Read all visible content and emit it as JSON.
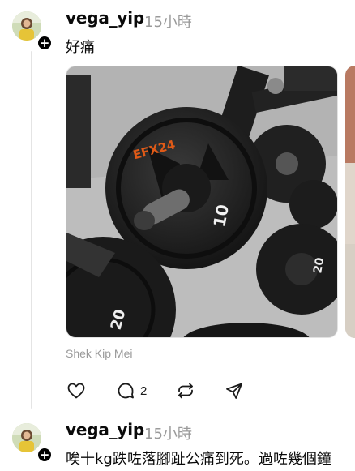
{
  "posts": [
    {
      "username": "vega_yip",
      "time": "15小時",
      "text": "好痛",
      "location": "Shek Kip Mei",
      "media": {
        "plate_brand": "EFX24",
        "plate_weight": "10",
        "plate_weight_small": "20"
      },
      "actions": {
        "like_icon": "heart-icon",
        "reply_icon": "comment-icon",
        "reply_count": "2",
        "repost_icon": "repost-icon",
        "share_icon": "send-icon"
      }
    },
    {
      "username": "vega_yip",
      "time": "15小時",
      "text": "唉十kg跌咗落腳趾公痛到死。過咗幾個鐘"
    }
  ],
  "follow_badge_symbol": "+"
}
